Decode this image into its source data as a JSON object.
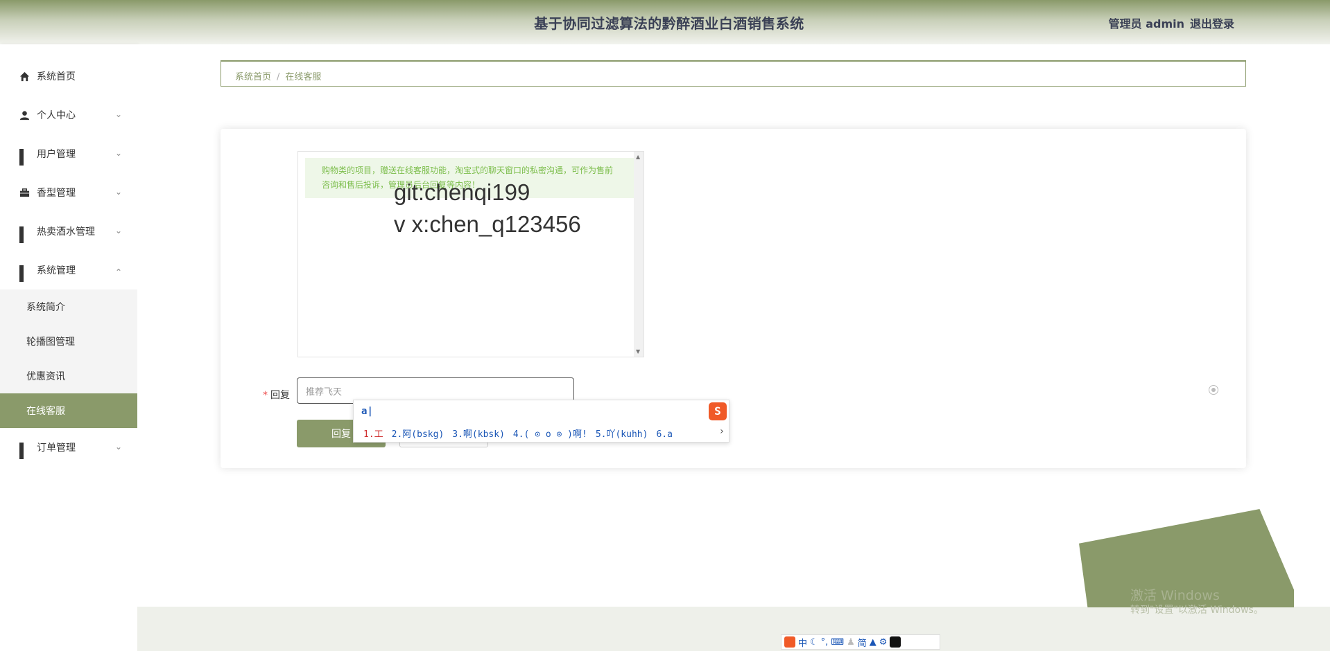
{
  "header": {
    "title": "基于协同过滤算法的黔醉酒业白酒销售系统",
    "user": "管理员 admin",
    "logout": "退出登录"
  },
  "sidebar": {
    "items": [
      {
        "label": "系统首页",
        "icon": "home-icon"
      },
      {
        "label": "个人中心",
        "icon": "user-icon"
      },
      {
        "label": "用户管理",
        "icon": "grid-icon"
      },
      {
        "label": "香型管理",
        "icon": "briefcase-icon"
      },
      {
        "label": "热卖酒水管理",
        "icon": "grid-icon"
      },
      {
        "label": "系统管理",
        "icon": "grid-icon"
      },
      {
        "label": "订单管理",
        "icon": "grid-icon"
      }
    ],
    "submenu": [
      "系统简介",
      "轮播图管理",
      "优惠资讯",
      "在线客服"
    ]
  },
  "breadcrumb": {
    "home": "系统首页",
    "separator": "/",
    "current": "在线客服"
  },
  "chat": {
    "notice": "购物类的项目，赠送在线客服功能，淘宝式的聊天窗口的私密沟通，可作为售前咨询和售后投诉，管理员后台回复等内容！",
    "watermark_line1": "git:chenqi199",
    "watermark_line2": "v x:chen_q123456"
  },
  "form": {
    "reply_label": "回复",
    "reply_input_value": "推荐飞天",
    "reply_button": "回复"
  },
  "ime": {
    "composition": "a",
    "candidates": [
      "1.工",
      "2.阿(bskg)",
      "3.啊(kbsk)",
      "4.( ⊙ o ⊙ )啊!",
      "5.吖(kuhh)",
      "6.a"
    ],
    "toolbar": [
      "中",
      "简"
    ]
  },
  "windows": {
    "activate_title": "激活 Windows",
    "activate_hint": "转到\"设置\"以激活 Windows。"
  },
  "colors": {
    "accent": "#8a9a6a",
    "title": "#3a4055",
    "notice_text": "#7bbd4a"
  }
}
